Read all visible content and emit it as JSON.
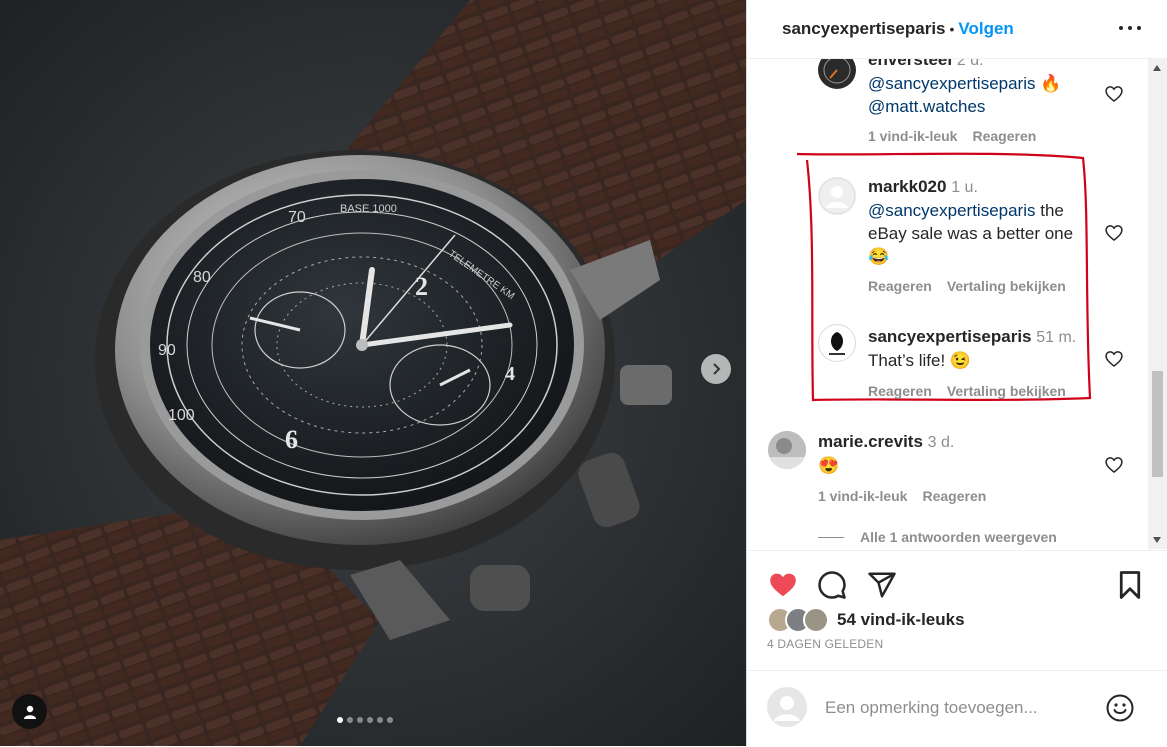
{
  "post": {
    "username": "sancyexpertiseparis",
    "separator": "•",
    "follow_label": "Volgen",
    "more_icon": "more-options-icon"
  },
  "media": {
    "dial_text_base": "BASE 1000",
    "dial_text_telemetre": "TELEMETRE KM",
    "numbers": [
      "70",
      "80",
      "90",
      "100",
      "2",
      "6",
      "4"
    ],
    "carousel_count": 6,
    "carousel_active": 1
  },
  "comments": [
    {
      "author": "enversteel",
      "time": "2 d.",
      "mentions": [
        "@sancyexpertiseparis",
        "@matt.watches"
      ],
      "emoji": "🔥",
      "likes_label": "1 vind-ik-leuk",
      "reply_label": "Reageren"
    },
    {
      "author": "markk020",
      "time": "1 u.",
      "mention": "@sancyexpertiseparis",
      "text": " the eBay sale was a better one",
      "emoji": "😂",
      "reply_label": "Reageren",
      "translate_label": "Vertaling bekijken"
    },
    {
      "author": "sancyexpertiseparis",
      "time": "51 m.",
      "text": "That’s life! ",
      "emoji": "😉",
      "reply_label": "Reageren",
      "translate_label": "Vertaling bekijken"
    },
    {
      "author": "marie.crevits",
      "time": "3 d.",
      "emoji": "😍",
      "likes_label": "1 vind-ik-leuk",
      "reply_label": "Reageren"
    }
  ],
  "view_replies_label": "Alle 1 antwoorden weergeven",
  "actions": {
    "liked": true,
    "like_color": "#ed4956",
    "likes_label": "54 vind-ik-leuks",
    "date_label": "4 DAGEN GELEDEN"
  },
  "composer": {
    "placeholder": "Een opmerking toevoegen..."
  },
  "colors": {
    "link": "#0095f6",
    "mention": "#00376b",
    "highlight": "#d0021b"
  }
}
